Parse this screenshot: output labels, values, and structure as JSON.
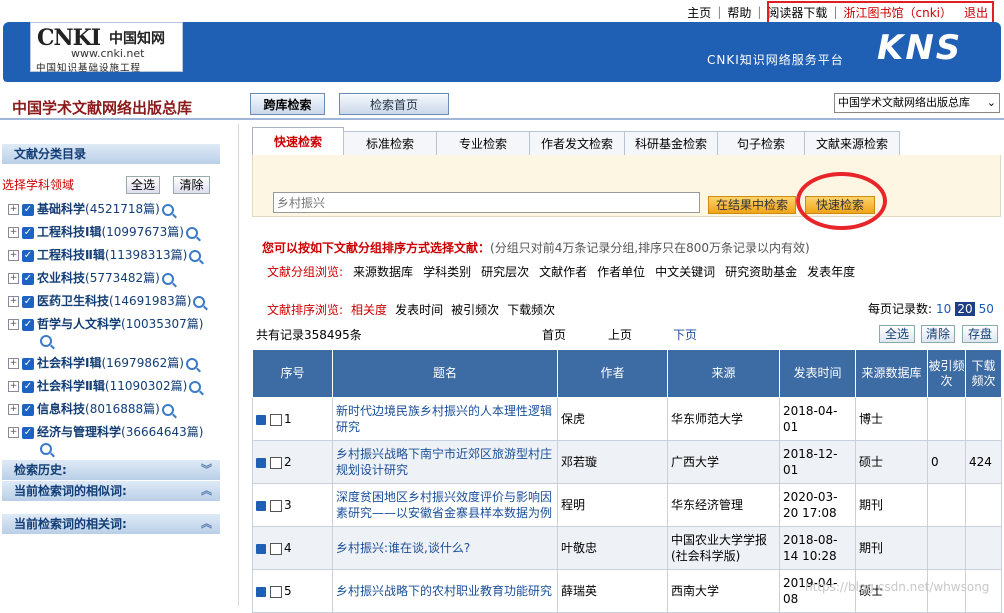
{
  "top_links": {
    "home": "主页",
    "help": "帮助",
    "reader": "阅读器下载",
    "library": "浙江图书馆（cnki）",
    "logout": "退出"
  },
  "header": {
    "logo_cnki": "CNKI",
    "logo_cn": "中国知网",
    "logo_url": "www.cnki.net",
    "logo_sub": "中国知识基础设施工程",
    "platform": "CNKI知识网络服务平台",
    "kns": "KNS"
  },
  "site_title": "中国学术文献网络出版总库",
  "nav": {
    "cross_search": "跨库检索",
    "search_home": "检索首页",
    "db_select": "中国学术文献网络出版总库"
  },
  "sidebar": {
    "catalog": "文献分类目录",
    "choose": "选择学科领域",
    "select_all": "全选",
    "clear": "清除",
    "categories": [
      {
        "name": "基础科学",
        "count": "(4521718篇)"
      },
      {
        "name": "工程科技Ⅰ辑",
        "count": "(10997673篇)"
      },
      {
        "name": "工程科技Ⅱ辑",
        "count": "(11398313篇)"
      },
      {
        "name": "农业科技",
        "count": "(5773482篇)"
      },
      {
        "name": "医药卫生科技",
        "count": "(14691983篇)"
      },
      {
        "name": "哲学与人文科学",
        "count": "(10035307篇)"
      },
      {
        "name": "社会科学Ⅰ辑",
        "count": "(16979862篇)"
      },
      {
        "name": "社会科学Ⅱ辑",
        "count": "(11090302篇)"
      },
      {
        "name": "信息科技",
        "count": "(8016888篇)"
      },
      {
        "name": "经济与管理科学",
        "count": "(36664643篇)"
      }
    ],
    "history": "检索历史:",
    "similar": "当前检索词的相似词:",
    "related": "当前检索词的相关词:"
  },
  "tabs": [
    "快速检索",
    "标准检索",
    "专业检索",
    "作者发文检索",
    "科研基金检索",
    "句子检索",
    "文献来源检索"
  ],
  "search": {
    "value": "乡村振兴",
    "in_result": "在结果中检索",
    "quick": "快速检索"
  },
  "group": {
    "hint_bold": "您可以按如下文献分组排序方式选择文献：",
    "hint_note": "(分组只对前4万条记录分组,排序只在800万条记录以内有效)",
    "label": "文献分组浏览:",
    "items": [
      "来源数据库",
      "学科类别",
      "研究层次",
      "文献作者",
      "作者单位",
      "中文关键词",
      "研究资助基金",
      "发表年度"
    ]
  },
  "sort": {
    "label": "文献排序浏览:",
    "items": [
      "相关度",
      "发表时间",
      "被引频次",
      "下载频次"
    ]
  },
  "per_page": {
    "label": "每页记录数:",
    "options": [
      "10",
      "20",
      "50"
    ],
    "current": "20"
  },
  "count": "共有记录358495条",
  "pager": {
    "first": "首页",
    "prev": "上页",
    "next": "下页"
  },
  "table_buttons": {
    "all": "全选",
    "clear": "清除",
    "save": "存盘"
  },
  "columns": [
    "序号",
    "题名",
    "作者",
    "来源",
    "发表时间",
    "来源数据库",
    "被引频次",
    "下载频次"
  ],
  "rows": [
    {
      "no": "1",
      "title": "新时代边境民族乡村振兴的人本理性逻辑研究",
      "author": "保虎",
      "source": "华东师范大学",
      "date": "2018-04-01",
      "db": "博士",
      "cited": "",
      "downloads": ""
    },
    {
      "no": "2",
      "title": "乡村振兴战略下南宁市近郊区旅游型村庄规划设计研究",
      "author": "邓若璇",
      "source": "广西大学",
      "date": "2018-12-01",
      "db": "硕士",
      "cited": "0",
      "downloads": "424"
    },
    {
      "no": "3",
      "title": "深度贫困地区乡村振兴效度评价与影响因素研究——以安徽省金寨县样本数据为例",
      "author": "程明",
      "source": "华东经济管理",
      "date": "2020-03-20 17:08",
      "db": "期刊",
      "cited": "",
      "downloads": ""
    },
    {
      "no": "4",
      "title": "乡村振兴:谁在谈,谈什么?",
      "author": "叶敬忠",
      "source": "中国农业大学学报(社会科学版)",
      "date": "2018-08-14 10:28",
      "db": "期刊",
      "cited": "",
      "downloads": ""
    },
    {
      "no": "5",
      "title": "乡村振兴战略下的农村职业教育功能研究",
      "author": "薛瑞英",
      "source": "西南大学",
      "date": "2019-04-08",
      "db": "硕士",
      "cited": "",
      "downloads": ""
    }
  ],
  "watermark": "https://blog.csdn.net/whwsong"
}
